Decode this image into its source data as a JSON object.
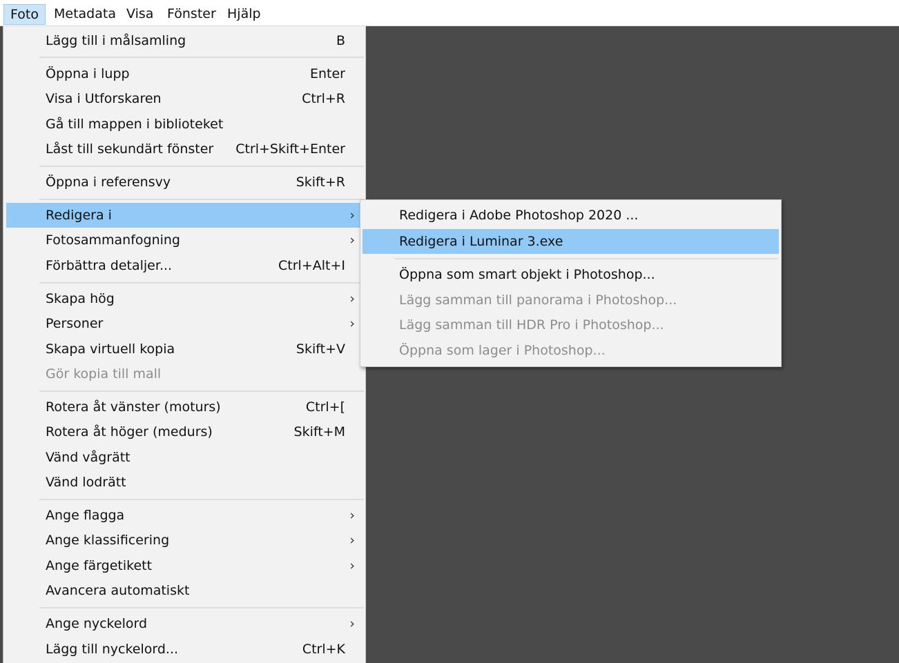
{
  "menubar": {
    "items": [
      {
        "label": "Foto"
      },
      {
        "label": "Metadata"
      },
      {
        "label": "Visa"
      },
      {
        "label": "Fönster"
      },
      {
        "label": "Hjälp"
      }
    ]
  },
  "dropdown": {
    "items": [
      {
        "label": "Lägg till i målsamling",
        "shortcut": "B"
      },
      {
        "label": "Öppna i lupp",
        "shortcut": "Enter"
      },
      {
        "label": "Visa i Utforskaren",
        "shortcut": "Ctrl+R"
      },
      {
        "label": "Gå till mappen i biblioteket",
        "shortcut": ""
      },
      {
        "label": "Låst till sekundärt fönster",
        "shortcut": "Ctrl+Skift+Enter"
      },
      {
        "label": "Öppna i referensvy",
        "shortcut": "Skift+R"
      },
      {
        "label": "Redigera i",
        "shortcut": "",
        "arrow": "›"
      },
      {
        "label": "Fotosammanfogning",
        "shortcut": "",
        "arrow": "›"
      },
      {
        "label": "Förbättra detaljer...",
        "shortcut": "Ctrl+Alt+I"
      },
      {
        "label": "Skapa hög",
        "shortcut": "",
        "arrow": "›"
      },
      {
        "label": "Personer",
        "shortcut": "",
        "arrow": "›"
      },
      {
        "label": "Skapa virtuell kopia",
        "shortcut": "Skift+V"
      },
      {
        "label": "Gör kopia till mall",
        "shortcut": ""
      },
      {
        "label": "Rotera åt vänster (moturs)",
        "shortcut": "Ctrl+["
      },
      {
        "label": "Rotera åt höger (medurs)",
        "shortcut": "Skift+M"
      },
      {
        "label": "Vänd vågrätt",
        "shortcut": ""
      },
      {
        "label": "Vänd lodrätt",
        "shortcut": ""
      },
      {
        "label": "Ange flagga",
        "shortcut": "",
        "arrow": "›"
      },
      {
        "label": "Ange klassificering",
        "shortcut": "",
        "arrow": "›"
      },
      {
        "label": "Ange färgetikett",
        "shortcut": "",
        "arrow": "›"
      },
      {
        "label": "Avancera automatiskt",
        "shortcut": ""
      },
      {
        "label": "Ange nyckelord",
        "shortcut": "",
        "arrow": "›"
      },
      {
        "label": "Lägg till nyckelord...",
        "shortcut": "Ctrl+K"
      }
    ]
  },
  "submenu": {
    "items": [
      {
        "label": "Redigera i Adobe Photoshop 2020 ..."
      },
      {
        "label": "Redigera i Luminar 3.exe"
      },
      {
        "label": "Öppna som smart objekt i Photoshop..."
      },
      {
        "label": "Lägg samman till panorama i Photoshop..."
      },
      {
        "label": "Lägg samman till HDR Pro i Photoshop..."
      },
      {
        "label": "Öppna som lager i Photoshop..."
      }
    ]
  }
}
